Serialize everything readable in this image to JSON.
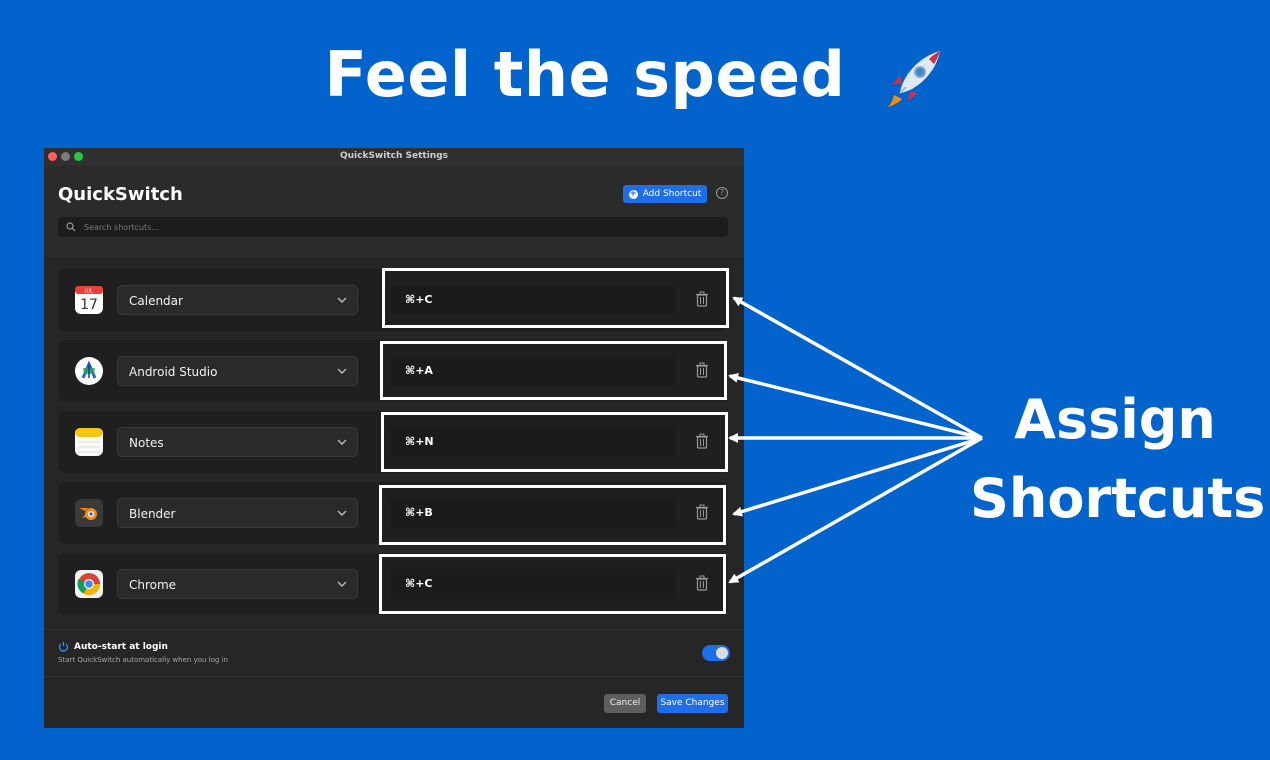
{
  "headline": "Feel the speed",
  "caption": [
    "Assign",
    "Shortcuts"
  ],
  "window": {
    "title": "QuickSwitch Settings",
    "app_name": "QuickSwitch",
    "add_button": "Add Shortcut",
    "help": "?",
    "search_placeholder": "Search shortcuts..."
  },
  "shortcuts": [
    {
      "app": "Calendar",
      "keys": "⌘+C",
      "icon": "calendar-icon",
      "calendar_month": "JUL",
      "calendar_day": "17"
    },
    {
      "app": "Android Studio",
      "keys": "⌘+A",
      "icon": "android-studio-icon"
    },
    {
      "app": "Notes",
      "keys": "⌘+N",
      "icon": "notes-icon"
    },
    {
      "app": "Blender",
      "keys": "⌘+B",
      "icon": "blender-icon"
    },
    {
      "app": "Chrome",
      "keys": "⌘+C",
      "icon": "chrome-icon"
    }
  ],
  "autostart": {
    "title": "Auto-start at login",
    "subtitle": "Start QuickSwitch automatically when you log in",
    "enabled": true
  },
  "footer": {
    "cancel": "Cancel",
    "save": "Save Changes"
  },
  "colors": {
    "background": "#0163cb",
    "accent": "#1d6ee8",
    "window": "#262626"
  }
}
